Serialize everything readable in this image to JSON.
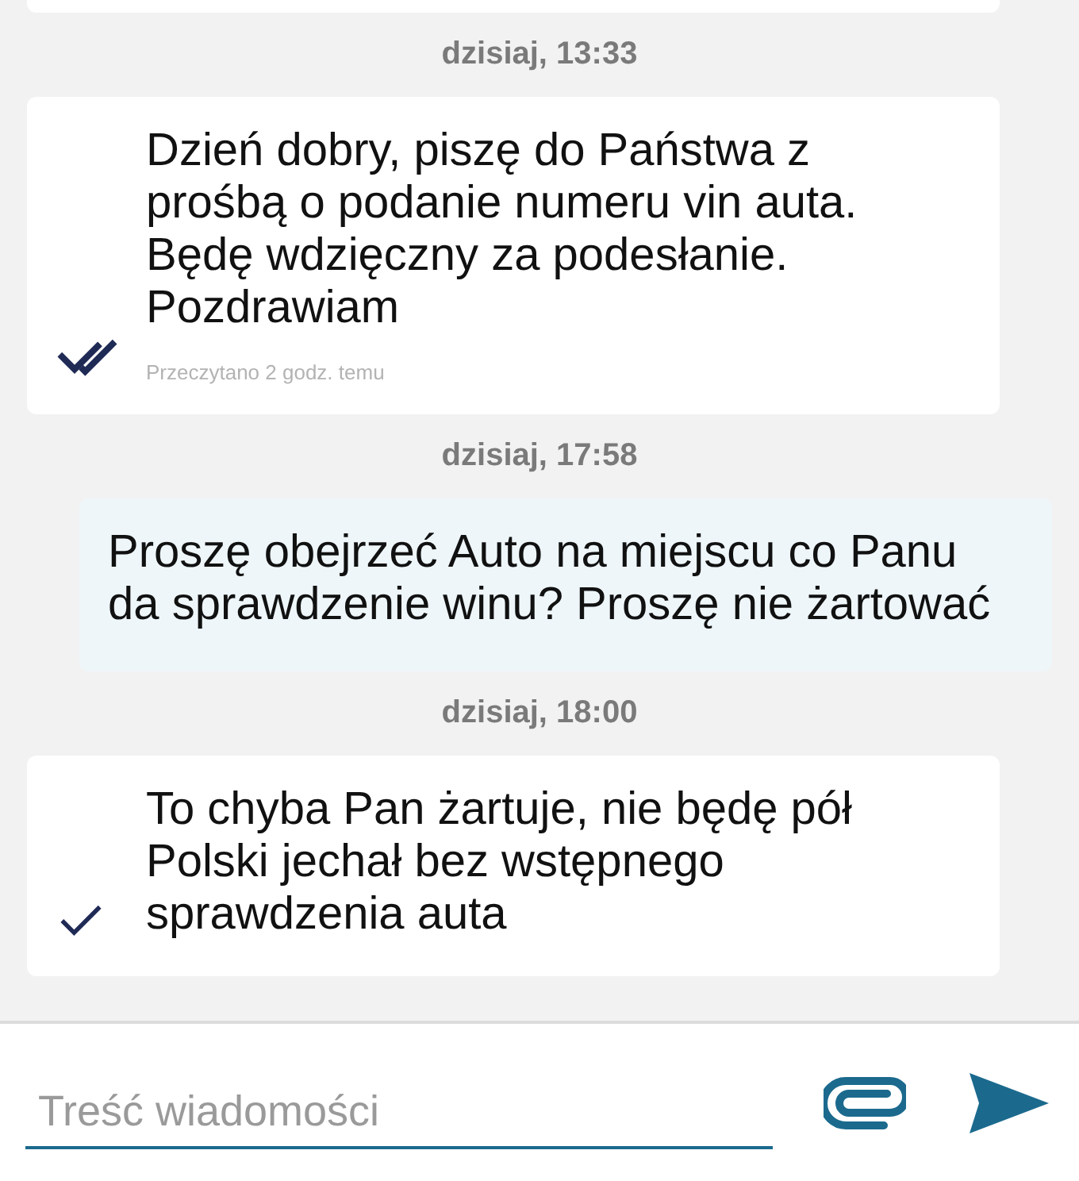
{
  "conversation": [
    {
      "kind": "outgoing"
    },
    {
      "kind": "date",
      "text": "dzisiaj, 13:33"
    },
    {
      "kind": "outgoing",
      "read": true,
      "text": "Dzień dobry, piszę do Państwa z prośbą o podanie numeru vin auta. Będę wdzięczny za podesłanie. Pozdrawiam",
      "receipt": "Przeczytano 2 godz. temu"
    },
    {
      "kind": "date",
      "text": "dzisiaj, 17:58"
    },
    {
      "kind": "incoming",
      "text": "Proszę obejrzeć Auto na miejscu co Panu da sprawdzenie winu? Proszę nie żartować"
    },
    {
      "kind": "date",
      "text": "dzisiaj, 18:00"
    },
    {
      "kind": "outgoing",
      "read": false,
      "text": "To chyba Pan żartuje, nie będę pół Polski jechał bez wstępnego sprawdzenia auta"
    }
  ],
  "composer": {
    "placeholder": "Treść wiadomości"
  }
}
